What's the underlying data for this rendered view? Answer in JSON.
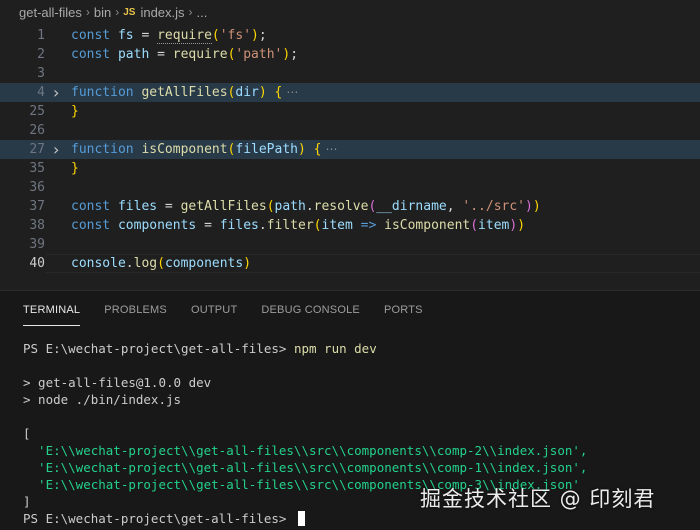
{
  "breadcrumb": {
    "folder1": "get-all-files",
    "folder2": "bin",
    "file_badge": "JS",
    "file": "index.js",
    "more": "..."
  },
  "editor": {
    "fold_marker": "⋯",
    "lines": [
      {
        "num": "1",
        "tokens": [
          [
            "kw",
            "const "
          ],
          [
            "var",
            "fs"
          ],
          [
            "op",
            " = "
          ],
          [
            "fn",
            "require"
          ],
          [
            "br1",
            "("
          ],
          [
            "str",
            "'fs'"
          ],
          [
            "br1",
            ")"
          ],
          [
            "op",
            ";"
          ]
        ]
      },
      {
        "num": "2",
        "tokens": [
          [
            "kw",
            "const "
          ],
          [
            "var",
            "path"
          ],
          [
            "op",
            " = "
          ],
          [
            "fn",
            "require"
          ],
          [
            "br1",
            "("
          ],
          [
            "str",
            "'path'"
          ],
          [
            "br1",
            ")"
          ],
          [
            "op",
            ";"
          ]
        ]
      },
      {
        "num": "3",
        "tokens": []
      },
      {
        "num": "4",
        "folded": true,
        "tokens": [
          [
            "kw",
            "function "
          ],
          [
            "fn",
            "getAllFiles"
          ],
          [
            "br1",
            "("
          ],
          [
            "param",
            "dir"
          ],
          [
            "br1",
            ")"
          ],
          [
            "op",
            " "
          ],
          [
            "br1",
            "{"
          ]
        ]
      },
      {
        "num": "25",
        "tokens": [
          [
            "br1",
            "}"
          ]
        ]
      },
      {
        "num": "26",
        "tokens": []
      },
      {
        "num": "27",
        "folded": true,
        "tokens": [
          [
            "kw",
            "function "
          ],
          [
            "fn",
            "isComponent"
          ],
          [
            "br1",
            "("
          ],
          [
            "param",
            "filePath"
          ],
          [
            "br1",
            ")"
          ],
          [
            "op",
            " "
          ],
          [
            "br1",
            "{"
          ]
        ]
      },
      {
        "num": "35",
        "tokens": [
          [
            "br1",
            "}"
          ]
        ]
      },
      {
        "num": "36",
        "tokens": []
      },
      {
        "num": "37",
        "tokens": [
          [
            "kw",
            "const "
          ],
          [
            "var",
            "files"
          ],
          [
            "op",
            " = "
          ],
          [
            "fn",
            "getAllFiles"
          ],
          [
            "br1",
            "("
          ],
          [
            "var",
            "path"
          ],
          [
            "op",
            "."
          ],
          [
            "fn",
            "resolve"
          ],
          [
            "br2",
            "("
          ],
          [
            "var",
            "__dirname"
          ],
          [
            "op",
            ", "
          ],
          [
            "str",
            "'../src'"
          ],
          [
            "br2",
            ")"
          ],
          [
            "br1",
            ")"
          ]
        ]
      },
      {
        "num": "38",
        "tokens": [
          [
            "kw",
            "const "
          ],
          [
            "var",
            "components"
          ],
          [
            "op",
            " = "
          ],
          [
            "var",
            "files"
          ],
          [
            "op",
            "."
          ],
          [
            "fn",
            "filter"
          ],
          [
            "br1",
            "("
          ],
          [
            "param",
            "item"
          ],
          [
            "op",
            " "
          ],
          [
            "kw",
            "=>"
          ],
          [
            "op",
            " "
          ],
          [
            "fn",
            "isComponent"
          ],
          [
            "br2",
            "("
          ],
          [
            "param",
            "item"
          ],
          [
            "br2",
            ")"
          ],
          [
            "br1",
            ")"
          ]
        ]
      },
      {
        "num": "39",
        "tokens": []
      },
      {
        "num": "40",
        "active": true,
        "tokens": [
          [
            "var",
            "console"
          ],
          [
            "op",
            "."
          ],
          [
            "fn",
            "log"
          ],
          [
            "br1",
            "("
          ],
          [
            "var",
            "components"
          ],
          [
            "br1",
            ")"
          ]
        ]
      }
    ]
  },
  "panel": {
    "tabs": [
      {
        "label": "TERMINAL",
        "active": true
      },
      {
        "label": "PROBLEMS"
      },
      {
        "label": "OUTPUT"
      },
      {
        "label": "DEBUG CONSOLE"
      },
      {
        "label": "PORTS"
      }
    ]
  },
  "terminal": {
    "prompt": "PS E:\\wechat-project\\get-all-files> ",
    "command": "npm run dev",
    "script_line1": "> get-all-files@1.0.0 dev",
    "script_line2": "> node ./bin/index.js",
    "open_bracket": "[",
    "results": [
      "  'E:\\\\wechat-project\\\\get-all-files\\\\src\\\\components\\\\comp-2\\\\index.json',",
      "  'E:\\\\wechat-project\\\\get-all-files\\\\src\\\\components\\\\comp-1\\\\index.json',",
      "  'E:\\\\wechat-project\\\\get-all-files\\\\src\\\\components\\\\comp-3\\\\index.json'"
    ],
    "close_bracket": "]",
    "final_prompt": "PS E:\\wechat-project\\get-all-files> "
  },
  "watermark": "掘金技术社区 @ 印刻君"
}
